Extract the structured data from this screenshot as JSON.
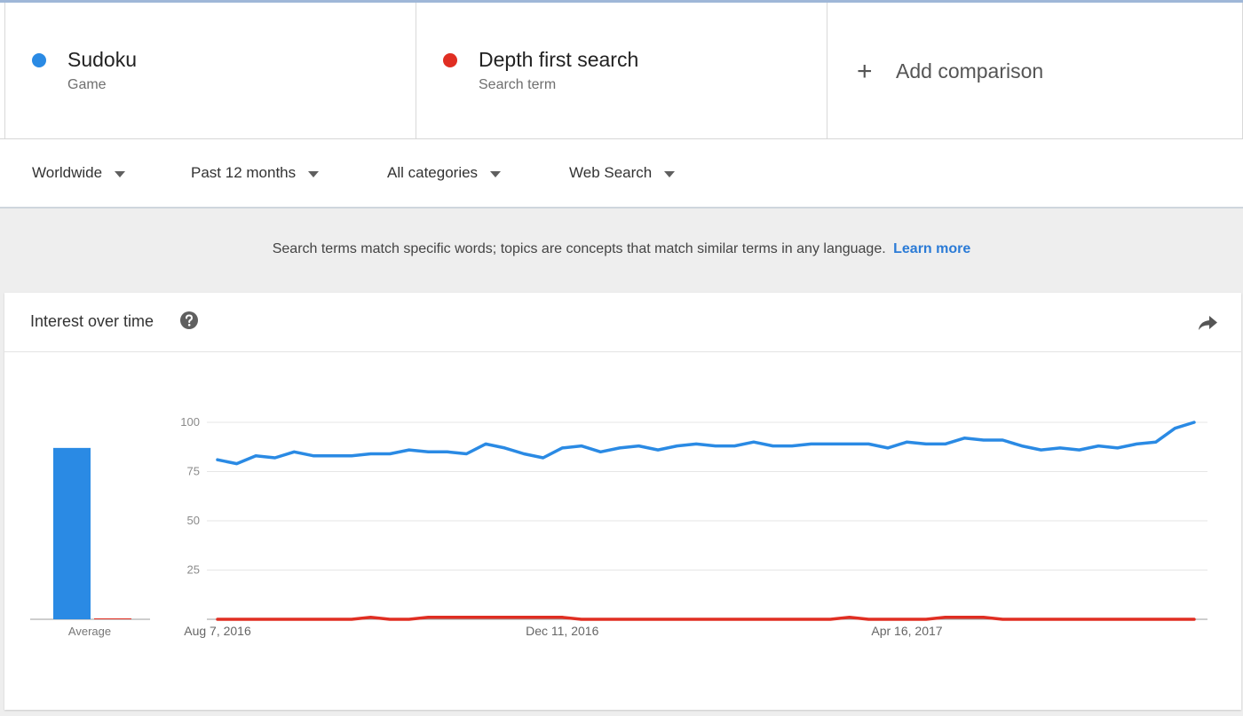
{
  "terms": [
    {
      "name": "Sudoku",
      "type": "Game",
      "color": "#2a8ae4"
    },
    {
      "name": "Depth first search",
      "type": "Search term",
      "color": "#e02e22"
    }
  ],
  "add_comparison": {
    "label": "Add comparison",
    "icon": "plus-icon"
  },
  "filters": {
    "region": "Worldwide",
    "time": "Past 12 months",
    "category": "All categories",
    "search_type": "Web Search"
  },
  "notice": {
    "text": "Search terms match specific words; topics are concepts that match similar terms in any language.",
    "link": "Learn more"
  },
  "card": {
    "title": "Interest over time",
    "help_icon": "question-circle-icon",
    "share_icon": "share-arrow-icon"
  },
  "chart_data": {
    "type": "line",
    "title": "Interest over time",
    "ylim": [
      0,
      100
    ],
    "y_ticks": [
      25,
      50,
      75,
      100
    ],
    "x_tick_labels": [
      {
        "label": "Aug 7, 2016",
        "index": 0
      },
      {
        "label": "Dec 11, 2016",
        "index": 18
      },
      {
        "label": "Apr 16, 2017",
        "index": 36
      }
    ],
    "average_label": "Average",
    "series": [
      {
        "name": "Sudoku",
        "color": "#2a8ae4",
        "average": 87,
        "values": [
          81,
          79,
          83,
          82,
          85,
          83,
          83,
          83,
          84,
          84,
          86,
          85,
          85,
          84,
          89,
          87,
          84,
          82,
          87,
          88,
          85,
          87,
          88,
          86,
          88,
          89,
          88,
          88,
          90,
          88,
          88,
          89,
          89,
          89,
          89,
          87,
          90,
          89,
          89,
          92,
          91,
          91,
          88,
          86,
          87,
          86,
          88,
          87,
          89,
          90,
          97,
          100
        ]
      },
      {
        "name": "Depth first search",
        "color": "#e02e22",
        "average": 0,
        "values": [
          0,
          0,
          0,
          0,
          0,
          0,
          0,
          0,
          1,
          0,
          0,
          1,
          1,
          1,
          1,
          1,
          1,
          1,
          1,
          0,
          0,
          0,
          0,
          0,
          0,
          0,
          0,
          0,
          0,
          0,
          0,
          0,
          0,
          1,
          0,
          0,
          0,
          0,
          1,
          1,
          1,
          0,
          0,
          0,
          0,
          0,
          0,
          0,
          0,
          0,
          0,
          0
        ]
      }
    ]
  }
}
